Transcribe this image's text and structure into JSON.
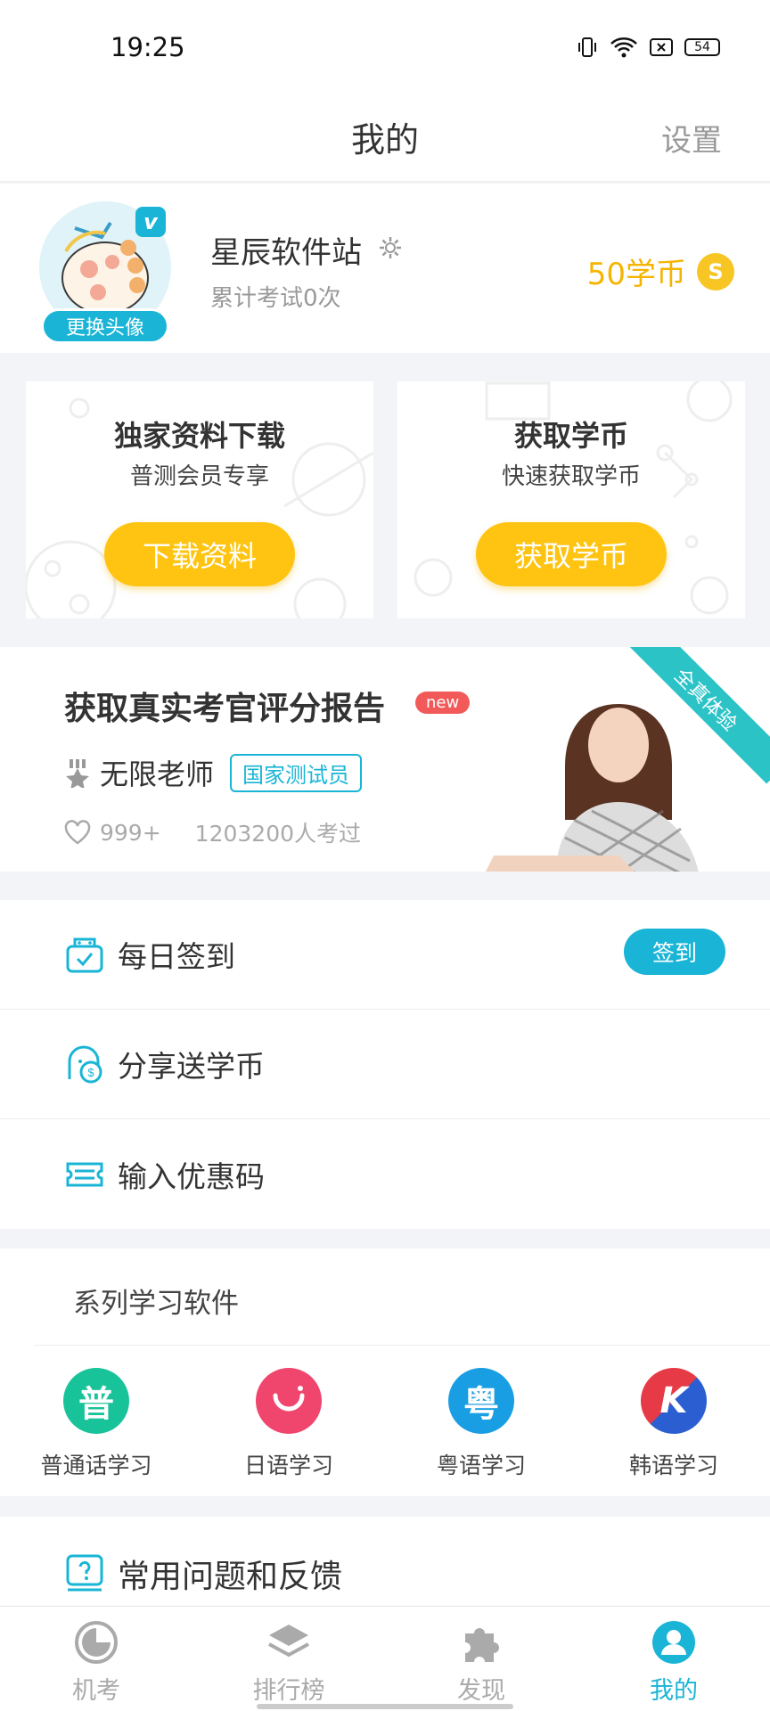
{
  "status_bar": {
    "time": "19:25",
    "battery": "54"
  },
  "header": {
    "title": "我的",
    "settings_label": "设置"
  },
  "profile": {
    "vip_badge": "v",
    "change_avatar_label": "更换头像",
    "username": "星辰软件站",
    "exam_count": "累计考试0次",
    "coins_label": "50学币",
    "coin_symbol": "S"
  },
  "promo_cards": [
    {
      "title": "独家资料下载",
      "subtitle": "普测会员专享",
      "button": "下载资料"
    },
    {
      "title": "获取学币",
      "subtitle": "快速获取学币",
      "button": "获取学币"
    }
  ],
  "teacher_banner": {
    "title": "获取真实考官评分报告",
    "new_badge": "new",
    "teacher_name": "无限老师",
    "teacher_tag": "国家测试员",
    "likes": "999+",
    "takers": "1203200人考过",
    "ribbon": "全真体验"
  },
  "menu": {
    "checkin": {
      "label": "每日签到",
      "button": "签到"
    },
    "share": {
      "label": "分享送学币"
    },
    "coupon": {
      "label": "输入优惠码"
    }
  },
  "series": {
    "title": "系列学习软件",
    "apps": [
      {
        "glyph": "普",
        "label": "普通话学习",
        "color": "#19c39a"
      },
      {
        "glyph": "",
        "label": "日语学习",
        "color": "#f0466e"
      },
      {
        "glyph": "粤",
        "label": "粤语学习",
        "color": "#1a9ee3"
      },
      {
        "glyph": "K",
        "label": "韩语学习",
        "color": "#e63a46"
      }
    ]
  },
  "faq": {
    "label": "常用问题和反馈"
  },
  "tabs": [
    {
      "label": "机考",
      "icon": "clock-icon",
      "active": false
    },
    {
      "label": "排行榜",
      "icon": "layers-icon",
      "active": false
    },
    {
      "label": "发现",
      "icon": "puzzle-icon",
      "active": false
    },
    {
      "label": "我的",
      "icon": "user-icon",
      "active": true
    }
  ],
  "colors": {
    "accent": "#1ab5d6",
    "yellow": "#fec411",
    "coin": "#f5b400"
  }
}
